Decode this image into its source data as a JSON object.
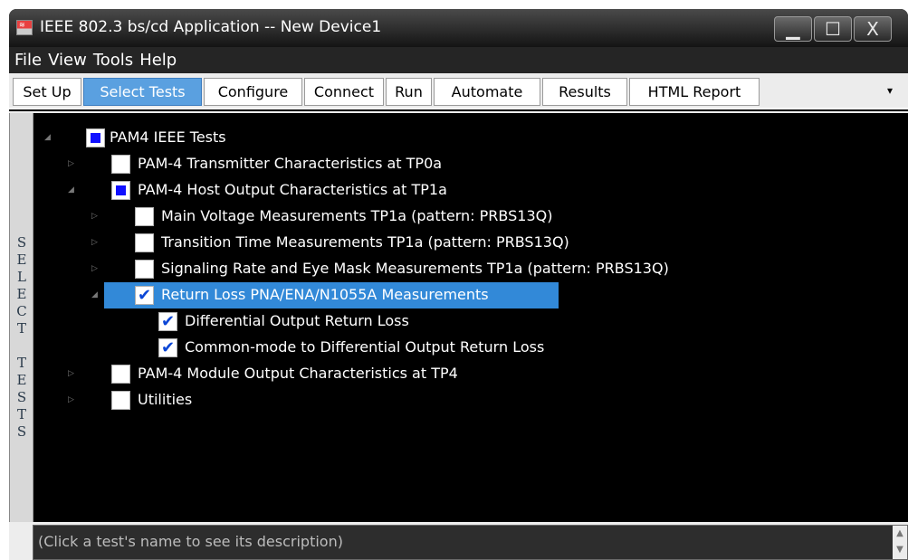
{
  "window": {
    "title": "IEEE 802.3 bs/cd Application -- New Device1",
    "minimize_glyph": "▁",
    "maximize_glyph": "☐",
    "close_glyph": "X"
  },
  "menu": [
    "File",
    "View",
    "Tools",
    "Help"
  ],
  "tabs": [
    {
      "label": "Set Up",
      "active": false
    },
    {
      "label": "Select Tests",
      "active": true
    },
    {
      "label": "Configure",
      "active": false
    },
    {
      "label": "Connect",
      "active": false
    },
    {
      "label": "Run",
      "active": false
    },
    {
      "label": "Automate",
      "active": false
    },
    {
      "label": "Results",
      "active": false
    },
    {
      "label": "HTML Report",
      "active": false
    }
  ],
  "tab_overflow_glyph": "▾",
  "side_label": "SELECT TESTS",
  "tree": [
    {
      "label": "PAM4 IEEE Tests",
      "state": "partial",
      "expander": "◢"
    },
    {
      "label": "PAM-4 Transmitter Characteristics at TP0a",
      "state": "unchecked",
      "expander": "▷"
    },
    {
      "label": "PAM-4 Host Output Characteristics at TP1a",
      "state": "partial",
      "expander": "◢"
    },
    {
      "label": "Main Voltage Measurements TP1a (pattern: PRBS13Q)",
      "state": "unchecked",
      "expander": "▷"
    },
    {
      "label": "Transition Time Measurements TP1a (pattern: PRBS13Q)",
      "state": "unchecked",
      "expander": "▷"
    },
    {
      "label": "Signaling Rate and Eye Mask Measurements TP1a (pattern: PRBS13Q)",
      "state": "unchecked",
      "expander": "▷"
    },
    {
      "label": "Return Loss PNA/ENA/N1055A Measurements",
      "state": "checked",
      "expander": "◢",
      "selected": true
    },
    {
      "label": "Differential Output Return Loss",
      "state": "checked",
      "expander": ""
    },
    {
      "label": "Common-mode to Differential Output Return Loss",
      "state": "checked",
      "expander": ""
    },
    {
      "label": "PAM-4 Module Output Characteristics at TP4",
      "state": "unchecked",
      "expander": "▷"
    },
    {
      "label": "Utilities",
      "state": "unchecked",
      "expander": "▷"
    }
  ],
  "check_glyph": "✔",
  "description": "(Click a test's name to see its description)",
  "scroll_up_glyph": "▲",
  "scroll_down_glyph": "▼"
}
